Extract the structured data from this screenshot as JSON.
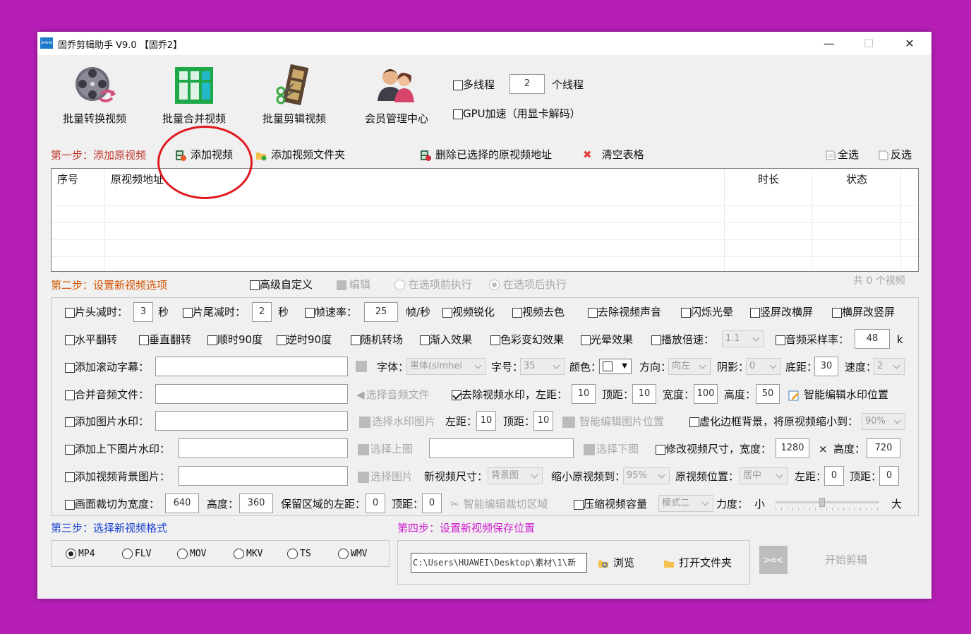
{
  "window": {
    "title": "固乔剪辑助手 V9.0 【固乔2】",
    "app_icon_text": ">=<"
  },
  "toolbar": {
    "batch_convert": "批量转换视频",
    "batch_merge": "批量合并视频",
    "batch_edit": "批量剪辑视频",
    "member_center": "会员管理中心",
    "multithread_label": "多线程",
    "thread_count": "2",
    "thread_unit": "个线程",
    "gpu_label": "GPU加速（用显卡解码）"
  },
  "step1": {
    "title": "第一步：添加原视频",
    "add_video": "添加视频",
    "add_folder": "添加视频文件夹",
    "delete_selected": "删除已选择的原视频地址",
    "clear_table": "清空表格",
    "select_all": "全选",
    "invert": "反选"
  },
  "table": {
    "columns": [
      "序号",
      "原视频地址",
      "时长",
      "状态"
    ]
  },
  "step2": {
    "title": "第二步：设置新视频选项",
    "advanced_custom": "高级自定义",
    "edit": "编辑",
    "before_exec": "在选项前执行",
    "after_exec": "在选项后执行",
    "count_text": "共 0 个视频",
    "row1": {
      "head_cut": "片头减时：",
      "head_val": "3",
      "sec1": "秒",
      "tail_cut": "片尾减时：",
      "tail_val": "2",
      "sec2": "秒",
      "fps": "帧速率：",
      "fps_val": "25",
      "fps_unit": "帧/秒",
      "sharpen": "视频锐化",
      "decolor": "视频去色",
      "remove_audio": "去除视频声音",
      "flash": "闪烁光晕",
      "v2h": "竖屏改横屏",
      "h2v": "横屏改竖屏"
    },
    "row2": {
      "hflip": "水平翻转",
      "vflip": "垂直翻转",
      "cw90": "顺时90度",
      "ccw90": "逆时90度",
      "random_trans": "随机转场",
      "fade_in": "渐入效果",
      "color_fx": "色彩变幻效果",
      "halo": "光晕效果",
      "speed": "播放倍速：",
      "speed_val": "1.1",
      "sample_rate": "音频采样率：",
      "sample_val": "48",
      "sample_unit": "k"
    },
    "row3": {
      "scroll_sub": "添加滚动字幕：",
      "font": "字体：",
      "font_val": "黑体(simhei",
      "size": "字号：",
      "size_val": "35",
      "color": "颜色：",
      "direction": "方向：",
      "direction_val": "向左",
      "shadow": "阴影：",
      "shadow_val": "0",
      "bottom": "底距：",
      "bottom_val": "30",
      "speed": "速度：",
      "speed_val": "2"
    },
    "row4": {
      "merge_audio": "合并音频文件：",
      "choose_audio": "选择音频文件",
      "remove_wm": "去除视频水印，左距：",
      "left_val": "10",
      "top": "顶距：",
      "top_val": "10",
      "width": "宽度：",
      "width_val": "100",
      "height": "高度：",
      "height_val": "50",
      "smart_wm": "智能编辑水印位置"
    },
    "row5": {
      "img_wm": "添加图片水印：",
      "choose_wm": "选择水印图片",
      "left": "左距：",
      "left_val": "10",
      "top": "顶距：",
      "top_val": "10",
      "smart_img": "智能编辑图片位置",
      "blur_border": "虚化边框背景，将原视频缩小到：",
      "blur_val": "90%"
    },
    "row6": {
      "tb_wm": "添加上下图片水印：",
      "choose_top": "选择上图",
      "choose_bottom": "选择下图",
      "resize": "修改视频尺寸，宽度：",
      "resize_w": "1280",
      "times": "×",
      "height": "高度：",
      "resize_h": "720"
    },
    "row7": {
      "bg_img": "添加视频背景图片：",
      "choose_img": "选择图片",
      "new_size": "新视频尺寸：",
      "new_size_val": "背景图",
      "shrink": "缩小原视频到：",
      "shrink_val": "95%",
      "pos": "原视频位置：",
      "pos_val": "居中",
      "left": "左距：",
      "left_val": "0",
      "top": "顶距：",
      "top_val": "0"
    },
    "row8": {
      "crop": "画面裁切为宽度：",
      "crop_w": "640",
      "height": "高度：",
      "crop_h": "360",
      "keep_left": "保留区域的左距：",
      "keep_left_val": "0",
      "top": "顶距：",
      "top_val": "0",
      "smart_crop": "智能编辑裁切区域",
      "compress": "压缩视频容量",
      "compress_mode": "模式二",
      "strength": "力度：",
      "small": "小",
      "big": "大",
      "strength_level": 0.45
    }
  },
  "step3": {
    "title": "第三步：选择新视频格式",
    "formats": [
      "MP4",
      "FLV",
      "MOV",
      "MKV",
      "TS",
      "WMV"
    ],
    "selected": "MP4"
  },
  "step4": {
    "title": "第四步：设置新视频保存位置",
    "path": "C:\\Users\\HUAWEI\\Desktop\\素材\\1\\新",
    "browse": "浏览",
    "open_folder": "打开文件夹",
    "start_icon": ">=<",
    "start": "开始剪辑"
  },
  "colors": {
    "background": "#b61fb6",
    "step1_title": "#c0392b",
    "step2_title": "#d35400",
    "step3_title": "#1a3fd1",
    "step4_title": "#d11fd1",
    "annotation_circle": "#e0191f"
  }
}
